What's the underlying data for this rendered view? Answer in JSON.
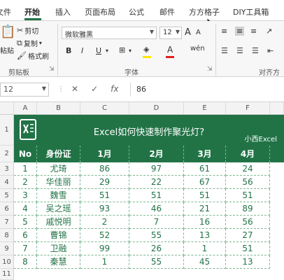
{
  "ribbon_tabs": [
    "文件",
    "开始",
    "插入",
    "页面布局",
    "公式",
    "邮件",
    "方方格子",
    "DIY工具箱"
  ],
  "active_tab": "开始",
  "clipboard": {
    "cut": "剪切",
    "copy": "复制",
    "format_painter": "格式刷",
    "paste": "粘贴",
    "group": "剪贴板"
  },
  "font": {
    "name": "微软雅黑",
    "size": "12",
    "group": "字体",
    "bold": "B",
    "italic": "I",
    "underline": "U",
    "grow": "A",
    "shrink": "A"
  },
  "align": {
    "group": "对齐方"
  },
  "formula_bar": {
    "name_box": "12",
    "fx": "fx",
    "value": "86"
  },
  "columns": [
    "A",
    "B",
    "C",
    "D",
    "E",
    "F"
  ],
  "rows": [
    "1",
    "2",
    "3",
    "4",
    "5",
    "6",
    "7",
    "8",
    "9",
    "10",
    "11"
  ],
  "banner": {
    "title": "Excel如何快速制作聚光灯?",
    "brand": "小西Excel",
    "logo": "excel-logo"
  },
  "table": {
    "headers": [
      "No",
      "身份证",
      "1月",
      "2月",
      "3月",
      "4月"
    ],
    "rows": [
      [
        "1",
        "尤琦",
        "86",
        "97",
        "61",
        "24"
      ],
      [
        "2",
        "华佳丽",
        "29",
        "22",
        "67",
        "56"
      ],
      [
        "3",
        "魏雪",
        "51",
        "51",
        "51",
        "51"
      ],
      [
        "4",
        "吴之瑶",
        "93",
        "46",
        "21",
        "89"
      ],
      [
        "5",
        "戚悦明",
        "2",
        "7",
        "16",
        "56"
      ],
      [
        "6",
        "曹锦",
        "52",
        "55",
        "13",
        "27"
      ],
      [
        "7",
        "卫融",
        "99",
        "26",
        "1",
        "51"
      ],
      [
        "8",
        "秦慧",
        "1",
        "55",
        "45",
        "13"
      ]
    ]
  },
  "colors": {
    "accent": "#217346",
    "text_green": "#217346"
  }
}
